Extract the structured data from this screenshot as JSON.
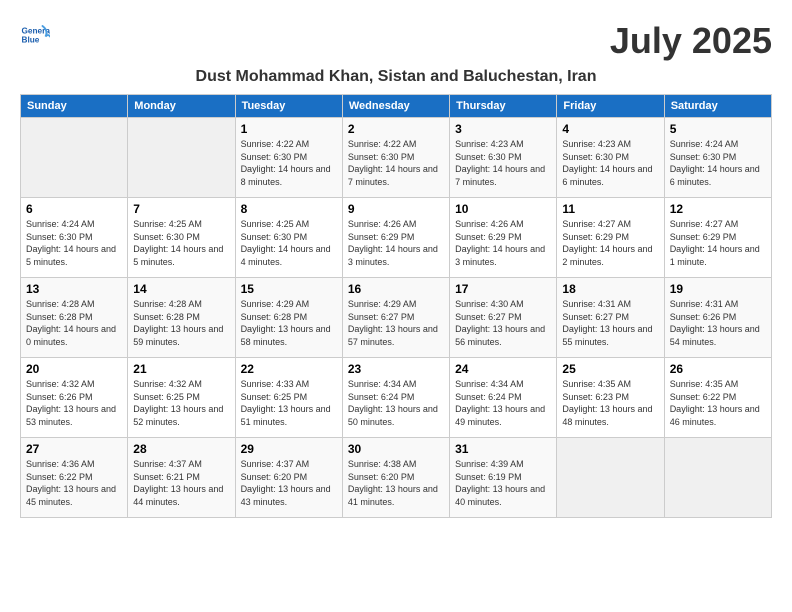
{
  "header": {
    "logo_line1": "General",
    "logo_line2": "Blue",
    "month_title": "July 2025",
    "location": "Dust Mohammad Khan, Sistan and Baluchestan, Iran"
  },
  "weekdays": [
    "Sunday",
    "Monday",
    "Tuesday",
    "Wednesday",
    "Thursday",
    "Friday",
    "Saturday"
  ],
  "weeks": [
    [
      {
        "day": "",
        "info": ""
      },
      {
        "day": "",
        "info": ""
      },
      {
        "day": "1",
        "info": "Sunrise: 4:22 AM\nSunset: 6:30 PM\nDaylight: 14 hours and 8 minutes."
      },
      {
        "day": "2",
        "info": "Sunrise: 4:22 AM\nSunset: 6:30 PM\nDaylight: 14 hours and 7 minutes."
      },
      {
        "day": "3",
        "info": "Sunrise: 4:23 AM\nSunset: 6:30 PM\nDaylight: 14 hours and 7 minutes."
      },
      {
        "day": "4",
        "info": "Sunrise: 4:23 AM\nSunset: 6:30 PM\nDaylight: 14 hours and 6 minutes."
      },
      {
        "day": "5",
        "info": "Sunrise: 4:24 AM\nSunset: 6:30 PM\nDaylight: 14 hours and 6 minutes."
      }
    ],
    [
      {
        "day": "6",
        "info": "Sunrise: 4:24 AM\nSunset: 6:30 PM\nDaylight: 14 hours and 5 minutes."
      },
      {
        "day": "7",
        "info": "Sunrise: 4:25 AM\nSunset: 6:30 PM\nDaylight: 14 hours and 5 minutes."
      },
      {
        "day": "8",
        "info": "Sunrise: 4:25 AM\nSunset: 6:30 PM\nDaylight: 14 hours and 4 minutes."
      },
      {
        "day": "9",
        "info": "Sunrise: 4:26 AM\nSunset: 6:29 PM\nDaylight: 14 hours and 3 minutes."
      },
      {
        "day": "10",
        "info": "Sunrise: 4:26 AM\nSunset: 6:29 PM\nDaylight: 14 hours and 3 minutes."
      },
      {
        "day": "11",
        "info": "Sunrise: 4:27 AM\nSunset: 6:29 PM\nDaylight: 14 hours and 2 minutes."
      },
      {
        "day": "12",
        "info": "Sunrise: 4:27 AM\nSunset: 6:29 PM\nDaylight: 14 hours and 1 minute."
      }
    ],
    [
      {
        "day": "13",
        "info": "Sunrise: 4:28 AM\nSunset: 6:28 PM\nDaylight: 14 hours and 0 minutes."
      },
      {
        "day": "14",
        "info": "Sunrise: 4:28 AM\nSunset: 6:28 PM\nDaylight: 13 hours and 59 minutes."
      },
      {
        "day": "15",
        "info": "Sunrise: 4:29 AM\nSunset: 6:28 PM\nDaylight: 13 hours and 58 minutes."
      },
      {
        "day": "16",
        "info": "Sunrise: 4:29 AM\nSunset: 6:27 PM\nDaylight: 13 hours and 57 minutes."
      },
      {
        "day": "17",
        "info": "Sunrise: 4:30 AM\nSunset: 6:27 PM\nDaylight: 13 hours and 56 minutes."
      },
      {
        "day": "18",
        "info": "Sunrise: 4:31 AM\nSunset: 6:27 PM\nDaylight: 13 hours and 55 minutes."
      },
      {
        "day": "19",
        "info": "Sunrise: 4:31 AM\nSunset: 6:26 PM\nDaylight: 13 hours and 54 minutes."
      }
    ],
    [
      {
        "day": "20",
        "info": "Sunrise: 4:32 AM\nSunset: 6:26 PM\nDaylight: 13 hours and 53 minutes."
      },
      {
        "day": "21",
        "info": "Sunrise: 4:32 AM\nSunset: 6:25 PM\nDaylight: 13 hours and 52 minutes."
      },
      {
        "day": "22",
        "info": "Sunrise: 4:33 AM\nSunset: 6:25 PM\nDaylight: 13 hours and 51 minutes."
      },
      {
        "day": "23",
        "info": "Sunrise: 4:34 AM\nSunset: 6:24 PM\nDaylight: 13 hours and 50 minutes."
      },
      {
        "day": "24",
        "info": "Sunrise: 4:34 AM\nSunset: 6:24 PM\nDaylight: 13 hours and 49 minutes."
      },
      {
        "day": "25",
        "info": "Sunrise: 4:35 AM\nSunset: 6:23 PM\nDaylight: 13 hours and 48 minutes."
      },
      {
        "day": "26",
        "info": "Sunrise: 4:35 AM\nSunset: 6:22 PM\nDaylight: 13 hours and 46 minutes."
      }
    ],
    [
      {
        "day": "27",
        "info": "Sunrise: 4:36 AM\nSunset: 6:22 PM\nDaylight: 13 hours and 45 minutes."
      },
      {
        "day": "28",
        "info": "Sunrise: 4:37 AM\nSunset: 6:21 PM\nDaylight: 13 hours and 44 minutes."
      },
      {
        "day": "29",
        "info": "Sunrise: 4:37 AM\nSunset: 6:20 PM\nDaylight: 13 hours and 43 minutes."
      },
      {
        "day": "30",
        "info": "Sunrise: 4:38 AM\nSunset: 6:20 PM\nDaylight: 13 hours and 41 minutes."
      },
      {
        "day": "31",
        "info": "Sunrise: 4:39 AM\nSunset: 6:19 PM\nDaylight: 13 hours and 40 minutes."
      },
      {
        "day": "",
        "info": ""
      },
      {
        "day": "",
        "info": ""
      }
    ]
  ]
}
